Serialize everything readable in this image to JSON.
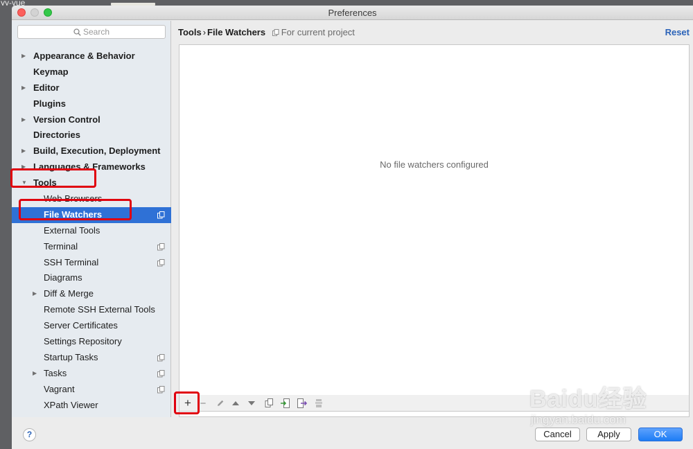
{
  "background": {
    "terminal_text": "yy-vue"
  },
  "window": {
    "title": "Preferences"
  },
  "search": {
    "placeholder": "Search"
  },
  "tree": [
    {
      "label": "Appearance & Behavior",
      "level": 0,
      "arrow": "▶"
    },
    {
      "label": "Keymap",
      "level": 0,
      "arrow": ""
    },
    {
      "label": "Editor",
      "level": 0,
      "arrow": "▶"
    },
    {
      "label": "Plugins",
      "level": 0,
      "arrow": ""
    },
    {
      "label": "Version Control",
      "level": 0,
      "arrow": "▶"
    },
    {
      "label": "Directories",
      "level": 0,
      "arrow": ""
    },
    {
      "label": "Build, Execution, Deployment",
      "level": 0,
      "arrow": "▶"
    },
    {
      "label": "Languages & Frameworks",
      "level": 0,
      "arrow": "▶"
    },
    {
      "label": "Tools",
      "level": 0,
      "arrow": "▼"
    },
    {
      "label": "Web Browsers",
      "level": 1,
      "arrow": ""
    },
    {
      "label": "File Watchers",
      "level": 1,
      "arrow": "",
      "selected": true,
      "project": true
    },
    {
      "label": "External Tools",
      "level": 1,
      "arrow": ""
    },
    {
      "label": "Terminal",
      "level": 1,
      "arrow": "",
      "project": true
    },
    {
      "label": "SSH Terminal",
      "level": 1,
      "arrow": "",
      "project": true
    },
    {
      "label": "Diagrams",
      "level": 1,
      "arrow": ""
    },
    {
      "label": "Diff & Merge",
      "level": 1,
      "arrow": "▶"
    },
    {
      "label": "Remote SSH External Tools",
      "level": 1,
      "arrow": ""
    },
    {
      "label": "Server Certificates",
      "level": 1,
      "arrow": ""
    },
    {
      "label": "Settings Repository",
      "level": 1,
      "arrow": ""
    },
    {
      "label": "Startup Tasks",
      "level": 1,
      "arrow": "",
      "project": true
    },
    {
      "label": "Tasks",
      "level": 1,
      "arrow": "▶",
      "project": true
    },
    {
      "label": "Vagrant",
      "level": 1,
      "arrow": "",
      "project": true
    },
    {
      "label": "XPath Viewer",
      "level": 1,
      "arrow": ""
    }
  ],
  "content": {
    "breadcrumb_parent": "Tools",
    "breadcrumb_sep": "›",
    "breadcrumb_current": "File Watchers",
    "scope": "For current project",
    "reset": "Reset",
    "empty_text": "No file watchers configured"
  },
  "toolbar": {
    "add": "+",
    "remove": "−",
    "icons": [
      "add-icon",
      "remove-icon",
      "edit-icon",
      "move-up-icon",
      "move-down-icon",
      "copy-icon",
      "import-icon",
      "export-icon",
      "disabled-stack-icon"
    ]
  },
  "footer": {
    "help": "?",
    "cancel": "Cancel",
    "apply": "Apply",
    "ok": "OK"
  },
  "watermark": {
    "brand": "Baidu经验",
    "url": "jingyan.baidu.com"
  },
  "colors": {
    "selection": "#2f71d6",
    "highlight": "#e0000e",
    "ok_button": "#1d7df5",
    "link": "#2b63b8"
  }
}
